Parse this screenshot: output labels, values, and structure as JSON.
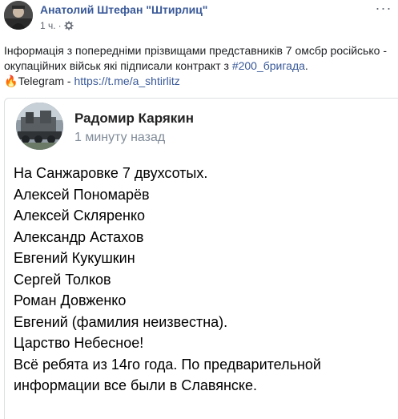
{
  "post": {
    "author": "Анатолий Штефан \"Штирлиц\"",
    "time": "1 ч.",
    "separator": "·",
    "audience_icon": "gear-icon",
    "more_icon": "more-icon",
    "more_glyph": "···",
    "text_part1": "Інформація з попередніми прізвищами представників 7 омсбр російсько - окупаційних військ які підписали контракт з ",
    "hashtag": "#200_бригада",
    "text_part2": ".",
    "fire_emoji": "🔥",
    "telegram_label": "Telegram - ",
    "telegram_link": "https://t.me/a_shtirlitz"
  },
  "embedded": {
    "name": "Радомир Карякин",
    "time": "1 минуту назад",
    "lines": [
      "На Санжаровке 7 двухсотых.",
      "Алексей Пономарёв",
      "Алексей Скляренко",
      "Александр Астахов",
      "Евгений Кукушкин",
      "Сергей Толков",
      "Роман Довженко",
      "Евгений (фамилия неизвестна).",
      "Царство Небесное!",
      "Всё ребята из 14го года. По предварительной",
      "информации все были в Славянске."
    ]
  },
  "colors": {
    "link": "#385898",
    "meta": "#616770",
    "divider": "#dddfe2",
    "secondary": "#818c99"
  }
}
